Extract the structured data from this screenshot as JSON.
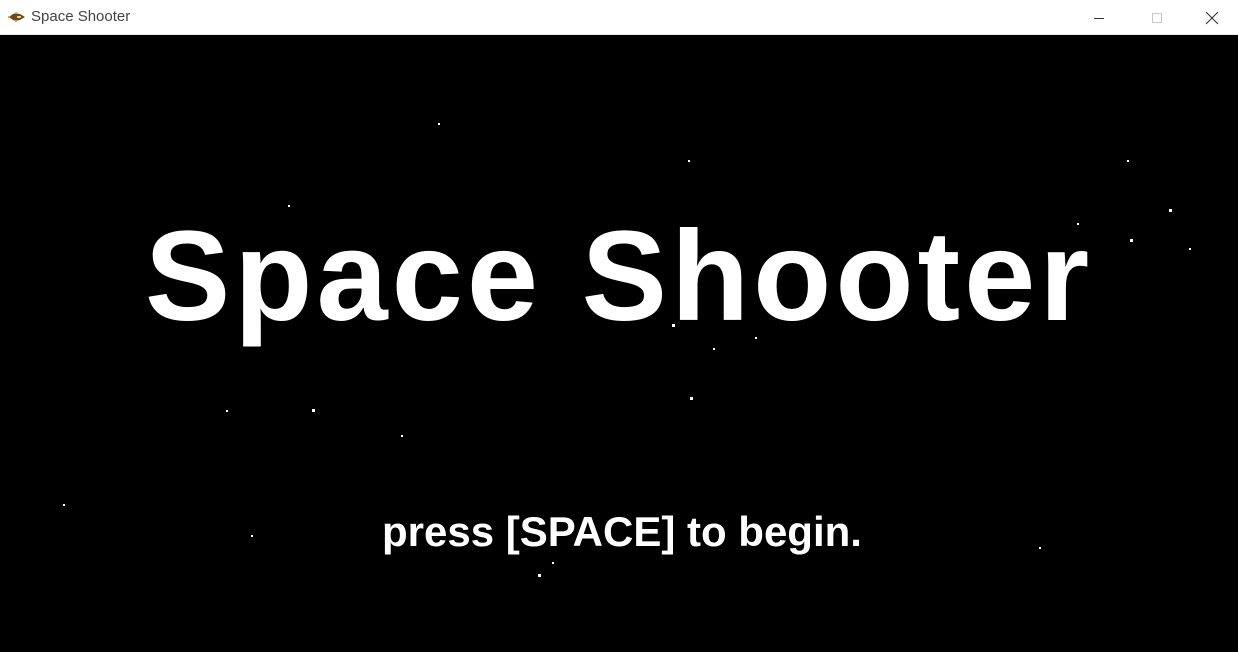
{
  "window": {
    "title": "Space Shooter",
    "icon": "spaceship-icon",
    "controls": [
      "minimize-icon",
      "maximize-icon",
      "close-icon"
    ]
  },
  "game": {
    "background_color": "#000000",
    "title": "Space Shooter",
    "prompt": "press [SPACE] to begin.",
    "text_color": "#ffffff"
  }
}
